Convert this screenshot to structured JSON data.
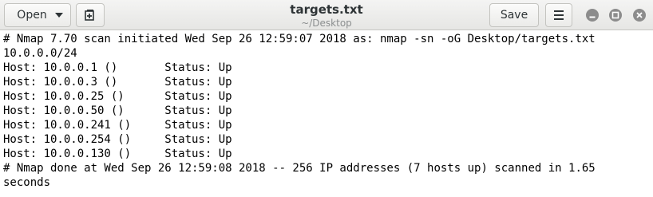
{
  "header": {
    "open_label": "Open",
    "title": "targets.txt",
    "subtitle": "~/Desktop",
    "save_label": "Save"
  },
  "editor": {
    "lines": [
      "# Nmap 7.70 scan initiated Wed Sep 26 12:59:07 2018 as: nmap -sn -oG Desktop/targets.txt",
      "10.0.0.0/24",
      "Host: 10.0.0.1 ()       Status: Up",
      "Host: 10.0.0.3 ()       Status: Up",
      "Host: 10.0.0.25 ()      Status: Up",
      "Host: 10.0.0.50 ()      Status: Up",
      "Host: 10.0.0.241 ()     Status: Up",
      "Host: 10.0.0.254 ()     Status: Up",
      "Host: 10.0.0.130 ()     Status: Up",
      "# Nmap done at Wed Sep 26 12:59:08 2018 -- 256 IP addresses (7 hosts up) scanned in 1.65",
      "seconds"
    ]
  }
}
